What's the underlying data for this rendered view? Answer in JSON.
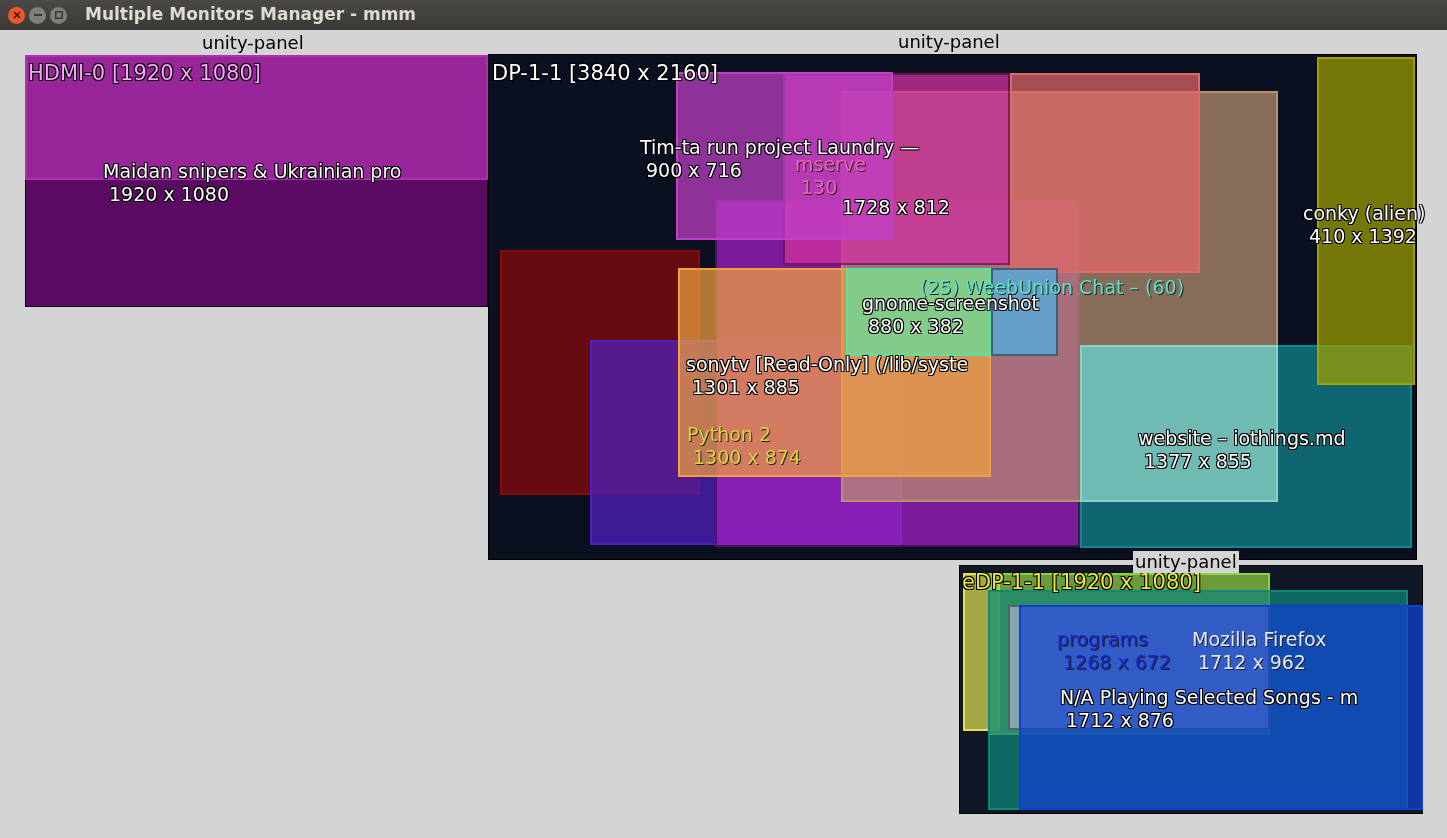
{
  "window": {
    "title": "Multiple Monitors Manager - mmm"
  },
  "monitors": [
    {
      "label": "HDMI-0  [1920 x 1080]",
      "panel_label": "unity-panel",
      "windows": [
        {
          "title": "Maidan snipers & Ukrainian pro",
          "size": "1920 x 1080",
          "color": "#b030b0",
          "kind": "outlined"
        }
      ]
    },
    {
      "label": "DP-1-1  [3840 x 2160]",
      "panel_label": "unity-panel",
      "windows": [
        {
          "color": "#8a0a0a"
        },
        {
          "color": "#5020c0"
        },
        {
          "title": "Python 2",
          "size": "1300 x 874",
          "color": "#e0d040",
          "kind": "tinted"
        },
        {
          "size": "1728 x 812",
          "color": "#b89070",
          "kind": "outlined"
        },
        {
          "color": "#e06868"
        },
        {
          "title": "mserve",
          "size": "130",
          "color": "#f060c0",
          "kind": "tinted"
        },
        {
          "title": "Tim-ta run project Laundry —",
          "size": "900 x 716",
          "color": "#c040c8",
          "kind": "outlined"
        },
        {
          "title": "sonytv [Read-Only] (/lib/syste",
          "size": "1301 x 885",
          "color": "#f0a040",
          "kind": "outlined"
        },
        {
          "title": "(25) WeebUnion Chat – (60)",
          "color": "#60e0c8",
          "kind": "tinted"
        },
        {
          "title": "gnome-screenshot",
          "size": "880 x 382",
          "color": "#60e0a0",
          "kind": "outlined"
        },
        {
          "color": "#108890"
        },
        {
          "title": "website – iothings.md",
          "size": "1377 x 855",
          "color": "#88d0c8",
          "kind": "outlined"
        },
        {
          "title": "conky (alien)",
          "size": "410 x 1392",
          "color": "#a0a000",
          "kind": "outlined"
        }
      ]
    },
    {
      "label": "eDP-1-1  [1920 x 1080]",
      "panel_label": "unity-panel",
      "windows": [
        {
          "color": "#e0e050"
        },
        {
          "color": "#90d040"
        },
        {
          "color": "#108878"
        },
        {
          "title": "programs",
          "size": "1268 x 672",
          "color": "#1828c8",
          "kind": "tinted"
        },
        {
          "title": "Mozilla Firefox",
          "size": "1712 x 962",
          "color": "#e4e8ff",
          "kind": "tinted"
        },
        {
          "title": "N/A Playing Selected Songs - m",
          "size": "1712 x 876",
          "color": "#1040d0",
          "kind": "outlined"
        }
      ]
    }
  ]
}
